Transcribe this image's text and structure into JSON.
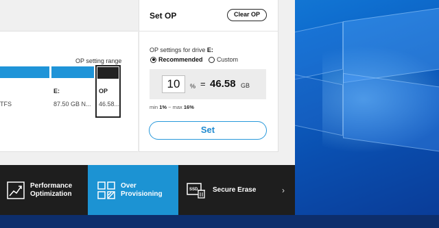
{
  "desktop": {
    "accent": "#0f6fd0"
  },
  "drive_map": {
    "range_label": "OP setting range",
    "segments": [
      {
        "label": "",
        "sub": "TFS"
      },
      {
        "label": "E:",
        "sub": "87.50 GB N..."
      },
      {
        "label": "OP",
        "sub": "46.58..."
      }
    ]
  },
  "set_op": {
    "title": "Set OP",
    "clear_label": "Clear OP",
    "drive_prefix": "OP settings for drive",
    "drive_name": "E:",
    "mode_options": [
      "Recommended",
      "Custom"
    ],
    "selected_mode": "Recommended",
    "percent_value": "10",
    "percent_unit": "%",
    "equals": "=",
    "size_value": "46.58",
    "size_unit": "GB",
    "min_label": "min",
    "min_value": "1%",
    "range_sep": "~",
    "max_label": "max",
    "max_value": "16%",
    "set_label": "Set"
  },
  "nav": {
    "items": [
      {
        "label_line1": "Performance",
        "label_line2": "Optimization",
        "icon": "chart-icon",
        "active": false
      },
      {
        "label_line1": "Over",
        "label_line2": "Provisioning",
        "icon": "grid-icon",
        "active": true
      },
      {
        "label_line1": "Secure Erase",
        "label_line2": "",
        "icon": "ssd-trash-icon",
        "active": false
      }
    ],
    "ssd_icon_text": "SSD",
    "chevron": "›"
  },
  "colors": {
    "primary": "#1c93d3",
    "nav_bg": "#1e1e1e",
    "bar_blue": "#1f94d8"
  }
}
